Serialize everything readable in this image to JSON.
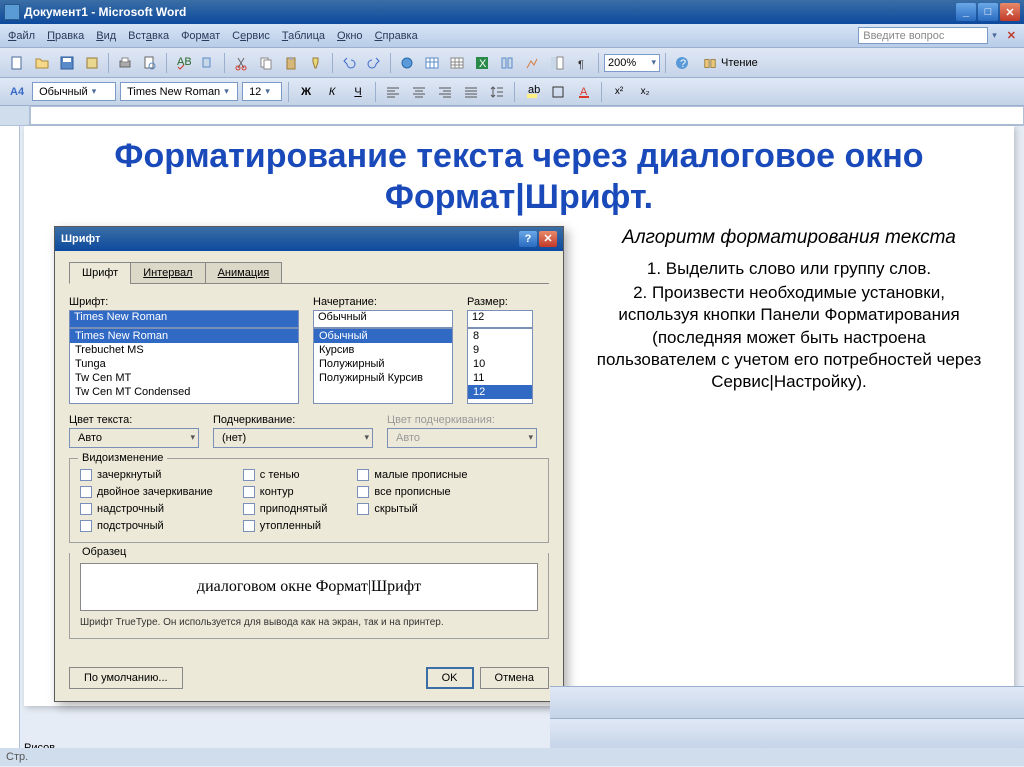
{
  "titlebar": {
    "text": "Документ1 - Microsoft Word"
  },
  "menubar": {
    "items": [
      {
        "pre": "",
        "u": "Ф",
        "post": "айл"
      },
      {
        "pre": "",
        "u": "П",
        "post": "равка"
      },
      {
        "pre": "",
        "u": "В",
        "post": "ид"
      },
      {
        "pre": "Вст",
        "u": "а",
        "post": "вка"
      },
      {
        "pre": "Фор",
        "u": "м",
        "post": "ат"
      },
      {
        "pre": "С",
        "u": "е",
        "post": "рвис"
      },
      {
        "pre": "",
        "u": "Т",
        "post": "аблица"
      },
      {
        "pre": "",
        "u": "О",
        "post": "кно"
      },
      {
        "pre": "",
        "u": "С",
        "post": "правка"
      }
    ],
    "help_placeholder": "Введите вопрос"
  },
  "toolbar": {
    "zoom": "200%",
    "read": "Чтение"
  },
  "format": {
    "style_style": "A4",
    "style": "Обычный",
    "font": "Times New Roman",
    "size": "12"
  },
  "doc": {
    "heading": "Форматирование текста через диалоговое окно Формат|Шрифт.",
    "subtitle": "Алгоритм форматирования текста",
    "steps": [
      "1. Выделить слово или группу слов.",
      "2. Произвести необходимые установки, используя кнопки Панели Форматирования (последняя может быть настроена пользователем с учетом его потребностей через Сервис|Настройку)."
    ]
  },
  "dialog": {
    "title": "Шрифт",
    "tabs": [
      "Шрифт",
      "Интервал",
      "Анимация"
    ],
    "font_label": "Шрифт:",
    "style_label": "Начертание:",
    "size_label": "Размер:",
    "font_value": "Times New Roman",
    "style_value": "Обычный",
    "size_value": "12",
    "font_list": [
      "Times New Roman",
      "Trebuchet MS",
      "Tunga",
      "Tw Cen MT",
      "Tw Cen MT Condensed"
    ],
    "style_list": [
      "Обычный",
      "Курсив",
      "Полужирный",
      "Полужирный Курсив"
    ],
    "size_list": [
      "8",
      "9",
      "10",
      "11",
      "12"
    ],
    "text_color_label": "Цвет текста:",
    "text_color": "Авто",
    "underline_label": "Подчеркивание:",
    "underline": "(нет)",
    "underline_color_label": "Цвет подчеркивания:",
    "underline_color": "Авто",
    "effects_group": "Видоизменение",
    "effects": {
      "c1": [
        "зачеркнутый",
        "двойное зачеркивание",
        "надстрочный",
        "подстрочный"
      ],
      "c2": [
        "с тенью",
        "контур",
        "приподнятый",
        "утопленный"
      ],
      "c3": [
        "малые прописные",
        "все прописные",
        "скрытый"
      ]
    },
    "sample_group": "Образец",
    "sample_text": "диалоговом окне Формат|Шрифт",
    "sample_note": "Шрифт TrueType. Он используется для вывода как на экран, так и на принтер.",
    "btn_default": "По умолчанию...",
    "btn_ok": "OK",
    "btn_cancel": "Отмена"
  },
  "bottom": {
    "draw": "Рисов",
    "status": "Стр."
  }
}
